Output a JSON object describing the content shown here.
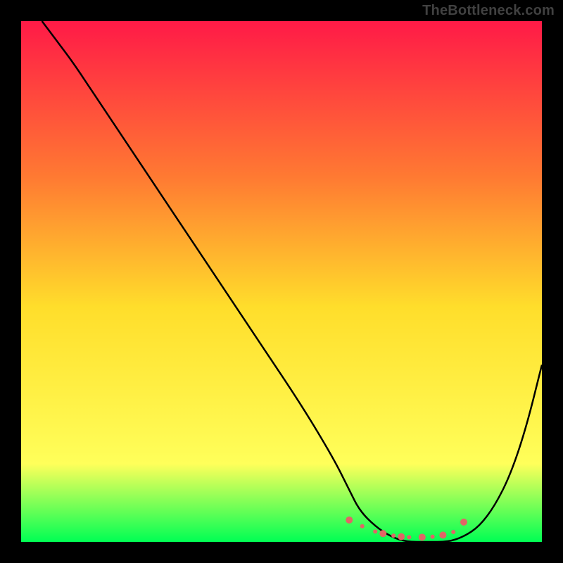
{
  "watermark": "TheBottleneck.com",
  "chart_data": {
    "type": "line",
    "title": "",
    "xlabel": "",
    "ylabel": "",
    "xlim": [
      0,
      100
    ],
    "ylim": [
      0,
      100
    ],
    "grid": false,
    "legend": false,
    "background_gradient": {
      "top": "#ff1a47",
      "mid1": "#ff7a32",
      "mid2": "#ffde2b",
      "mid3": "#ffff5a",
      "bottom": "#00ff54"
    },
    "series": [
      {
        "name": "bottleneck-curve",
        "color": "#000000",
        "x": [
          4,
          7,
          10,
          14,
          18,
          24,
          30,
          38,
          46,
          54,
          60,
          63,
          65,
          68,
          71,
          74,
          78,
          82,
          85,
          88,
          91,
          94,
          97,
          100
        ],
        "y": [
          100,
          96,
          92,
          86,
          80,
          71,
          62,
          50,
          38,
          26,
          16,
          10,
          6,
          3,
          1,
          0,
          0,
          0,
          1,
          3,
          7,
          13,
          22,
          34
        ]
      }
    ],
    "markers": {
      "name": "bottom-dots",
      "color": "#e06666",
      "radius_main": 5,
      "radius_small": 3,
      "points_x": [
        63,
        65.5,
        68,
        69.5,
        71.5,
        73,
        74.5,
        77,
        79,
        81,
        83,
        85
      ],
      "points_y": [
        4.2,
        3.0,
        2.0,
        1.6,
        1.2,
        1.0,
        0.9,
        0.9,
        1.0,
        1.3,
        1.9,
        3.8
      ],
      "is_large": [
        true,
        false,
        false,
        true,
        false,
        true,
        false,
        true,
        false,
        true,
        false,
        true
      ]
    }
  }
}
